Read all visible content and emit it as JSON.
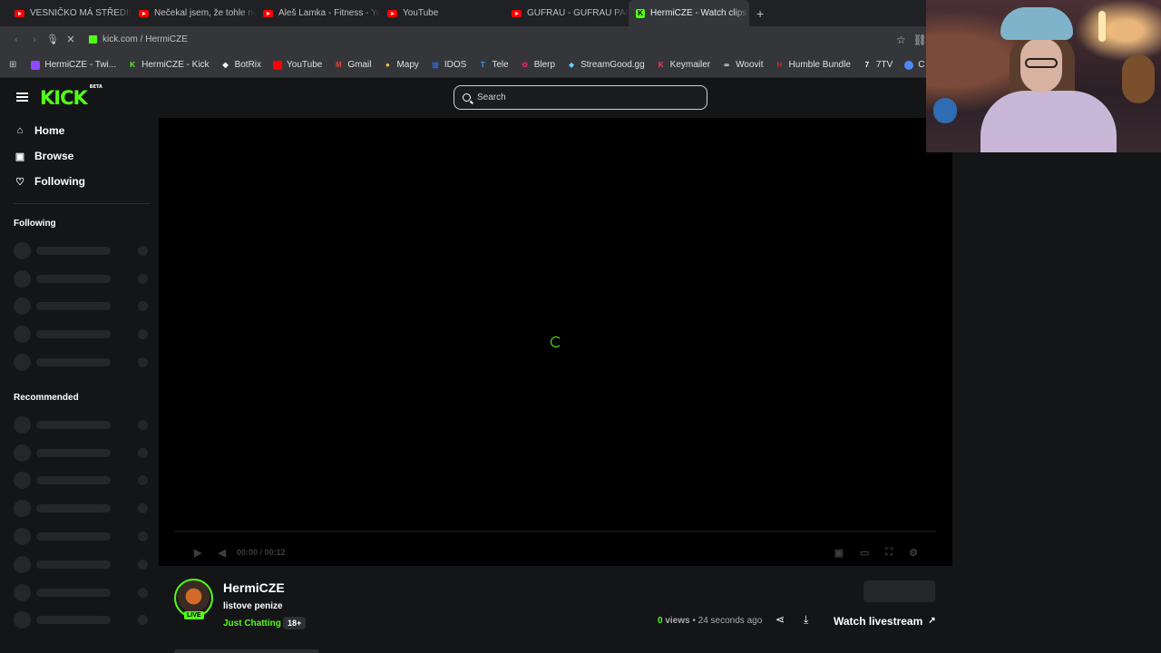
{
  "browser": {
    "tabs": [
      {
        "label": "VESNIČKO MÁ STŘEDISKOVÁ",
        "icon": "youtube-icon",
        "active": false
      },
      {
        "label": "Nečekal jsem, že tohle někdy",
        "icon": "youtube-icon",
        "active": false
      },
      {
        "label": "Aleš Lamka - Fitness - YouTube",
        "icon": "youtube-icon",
        "active": false
      },
      {
        "label": "YouTube",
        "icon": "youtube-icon",
        "active": false
      },
      {
        "label": "GUFRAU - GUFRAU PARTY",
        "icon": "youtube-icon",
        "active": false
      },
      {
        "label": "HermiCZE - Watch clips on",
        "icon": "kick-icon",
        "active": true
      }
    ],
    "new_tab": "+",
    "url": "kick.com / HermiCZE",
    "bookmarks": [
      {
        "label": "HermiCZE - Twi...",
        "icon": "twitch-icon",
        "color": "#9146ff"
      },
      {
        "label": "HermiCZE - Kick",
        "icon": "kick-icon",
        "color": "#53fc18"
      },
      {
        "label": "BotRix",
        "icon": "botrix-icon",
        "color": "#ffffff"
      },
      {
        "label": "YouTube",
        "icon": "youtube-icon",
        "color": "#ff0000"
      },
      {
        "label": "Gmail",
        "icon": "gmail-icon",
        "color": "#ea4335"
      },
      {
        "label": "Mapy",
        "icon": "map-pin-icon",
        "color": "#f2c94c"
      },
      {
        "label": "IDOS",
        "icon": "idos-icon",
        "color": "#2d6bd6"
      },
      {
        "label": "Tele",
        "icon": "tele-icon",
        "color": "#3aa0ff"
      },
      {
        "label": "Blerp",
        "icon": "blerp-icon",
        "color": "#e0245e"
      },
      {
        "label": "StreamGood.gg",
        "icon": "streamgood-icon",
        "color": "#6bd0ff"
      },
      {
        "label": "Keymailer",
        "icon": "keymailer-icon",
        "color": "#ff3b5c"
      },
      {
        "label": "Woovit",
        "icon": "woovit-icon",
        "color": "#ffffff"
      },
      {
        "label": "Humble Bundle",
        "icon": "humble-icon",
        "color": "#cc2929"
      },
      {
        "label": "7TV",
        "icon": "7tv-icon",
        "color": "#ffffff"
      },
      {
        "label": "C",
        "icon": "chrome-icon",
        "color": "#4c8bf5"
      }
    ]
  },
  "site": {
    "logo": "KICK",
    "logo_badge": "BETA",
    "search_placeholder": "Search",
    "nav": [
      {
        "label": "Home",
        "icon": "home-icon"
      },
      {
        "label": "Browse",
        "icon": "browse-icon"
      },
      {
        "label": "Following",
        "icon": "heart-icon"
      }
    ],
    "following_heading": "Following",
    "recommended_heading": "Recommended",
    "player": {
      "time": "00:00 / 00:12"
    },
    "channel": {
      "name": "HermiCZE",
      "title": "listove penize",
      "category": "Just Chatting",
      "age_badge": "18+",
      "live_badge": "LIVE",
      "views_count": "0",
      "views_label": "views",
      "time_ago": "24 seconds ago",
      "watch_label": "Watch livestream"
    }
  },
  "colors": {
    "accent": "#53fc18",
    "background": "#141517",
    "player": "#000000"
  }
}
